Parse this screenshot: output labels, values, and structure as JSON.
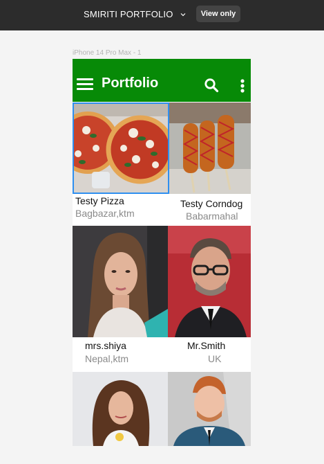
{
  "viewer": {
    "file_title": "SMIRITI PORTFOLIO",
    "view_only_label": "View only",
    "frame_label": "iPhone 14 Pro Max - 1"
  },
  "app": {
    "title": "Portfolio",
    "accent_color": "#078a07",
    "icons": [
      "menu-icon",
      "search-icon",
      "more-vert-icon"
    ]
  },
  "items": [
    {
      "name": "Testy Pizza",
      "location": "Bagbazar,ktm",
      "image": "pizza-photo"
    },
    {
      "name": "Testy Corndog",
      "location": "Babarmahal",
      "image": "corndog-photo"
    },
    {
      "name": "mrs.shiya",
      "location": "Nepal,ktm",
      "image": "woman-portrait-photo"
    },
    {
      "name": "Mr.Smith",
      "location": "UK",
      "image": "man-portrait-photo"
    },
    {
      "name": "",
      "location": "",
      "image": "curly-hair-woman-photo"
    },
    {
      "name": "",
      "location": "",
      "image": "red-hair-man-photo"
    }
  ]
}
